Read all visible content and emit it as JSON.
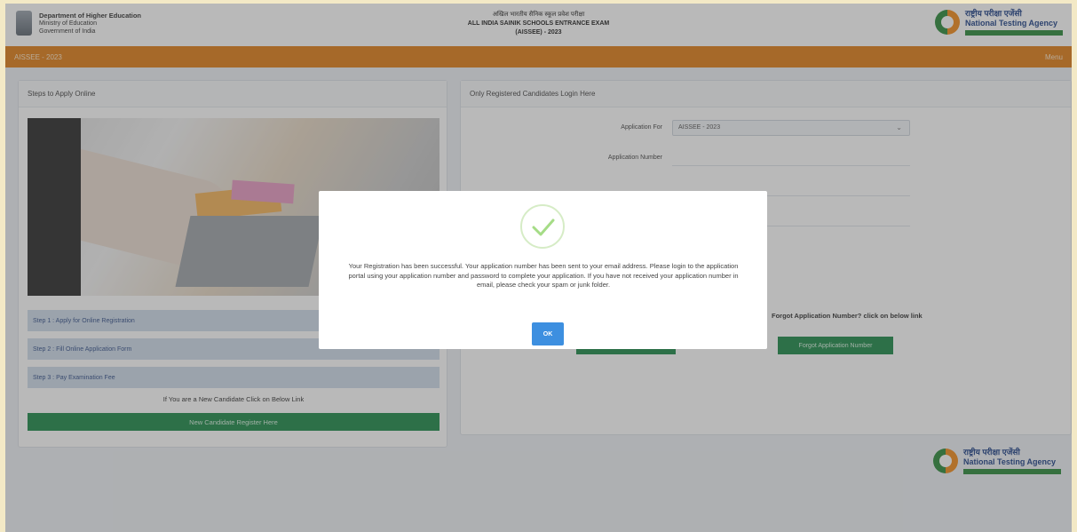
{
  "header": {
    "dept_line1": "Department of Higher Education",
    "dept_line2": "Ministry of Education",
    "dept_line3": "Government of India",
    "title_hindi": "अखिल भारतीय सैनिक स्कूल प्रवेश परीक्षा",
    "title_en": "ALL INDIA SAINIK SCHOOLS ENTRANCE EXAM",
    "title_year": "(AISSEE) - 2023",
    "nta_hindi": "राष्ट्रीय परीक्षा एजेंसी",
    "nta_en": "National Testing Agency"
  },
  "orangebar": {
    "left": "AISSEE - 2023",
    "right": "Menu"
  },
  "left_panel": {
    "title": "Steps to Apply Online",
    "steps": [
      "Step 1 : Apply for Online Registration",
      "Step 2 : Fill Online Application Form",
      "Step 3 : Pay Examination Fee"
    ],
    "new_candidate_text": "If You are a New Candidate Click on Below Link",
    "register_button": "New Candidate Register Here"
  },
  "right_panel": {
    "title": "Only Registered Candidates Login Here",
    "application_for_label": "Application For",
    "application_for_value": "AISSEE - 2023",
    "application_number_label": "Application Number",
    "forgot_text": "Forgot Application Number? click on below link",
    "forgot_button": "Forgot Application Number"
  },
  "modal": {
    "message": "Your Registration has been successful. Your application number has been sent to your email address. Please login to the application portal using your application number and password to complete your application. If you have not received your application number in email, please check your spam or junk folder.",
    "ok_label": "OK"
  },
  "colors": {
    "orange": "#e07e18",
    "green": "#1e8a4a",
    "blue": "#3d8fe0"
  }
}
